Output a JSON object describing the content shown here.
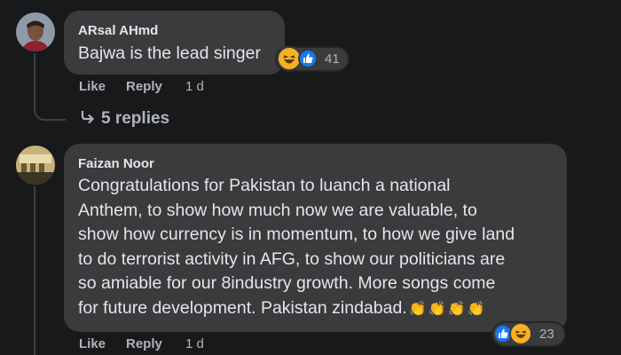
{
  "comments": [
    {
      "author": "ARsal AHmd",
      "text_lines": [
        "Bajwa is the lead singer"
      ],
      "reaction_count": "41",
      "actions": {
        "like": "Like",
        "reply": "Reply",
        "time": "1 d"
      },
      "replies_label": "5 replies"
    },
    {
      "author": "Faizan Noor",
      "text_lines": [
        "Congratulations for Pakistan to luanch a national",
        "Anthem, to show how much now we are valuable, to",
        "show how currency is in momentum, to how we give land",
        "to do terrorist activity in AFG, to show our politicians are",
        "so amiable for our 8industry growth. More songs come",
        "for future development. Pakistan zindabad."
      ],
      "reaction_count": "23",
      "actions": {
        "like": "Like",
        "reply": "Reply",
        "time": "1 d"
      }
    }
  ],
  "icons": {
    "like": "like-reaction-icon",
    "haha": "haha-reaction-icon",
    "clap": "clapping-hands-emoji",
    "reply_arrow": "reply-arrow-icon"
  },
  "colors": {
    "background": "#18191a",
    "bubble": "#3a3b3c",
    "text": "#e4e6eb",
    "secondary": "#b0b3b8",
    "like_blue": "#1877f2",
    "haha_yellow": "#f7b125"
  }
}
